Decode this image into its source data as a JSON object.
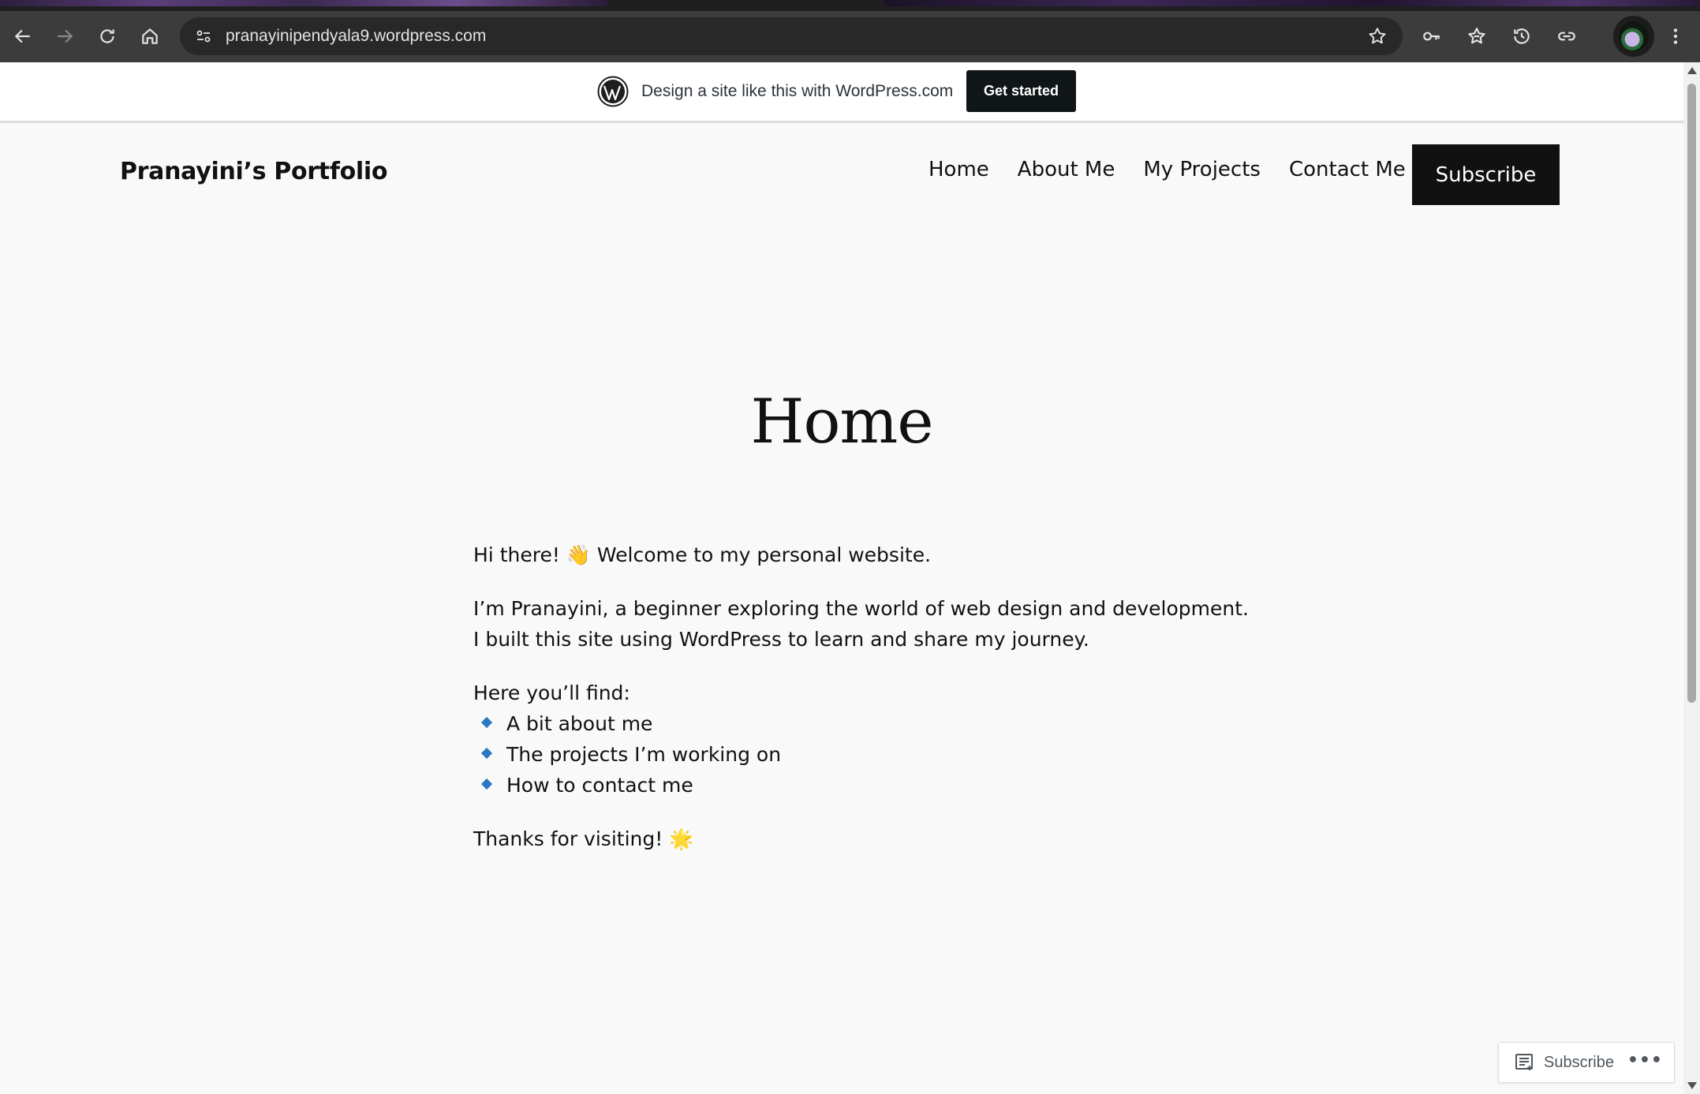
{
  "browser": {
    "url": "pranayinipendyala9.wordpress.com",
    "icons": [
      "back-icon",
      "forward-icon",
      "reload-icon",
      "home-icon",
      "site-info-icon",
      "bookmark-star-icon",
      "password-key-icon",
      "favorites-icon",
      "history-icon",
      "link-icon",
      "profile-avatar",
      "menu-icon"
    ]
  },
  "wp_banner": {
    "text": "Design a site like this with WordPress.com",
    "button": "Get started"
  },
  "site": {
    "title": "Pranayini’s Portfolio",
    "nav": [
      {
        "label": "Home"
      },
      {
        "label": "About Me"
      },
      {
        "label": "My Projects"
      },
      {
        "label": "Contact Me"
      }
    ],
    "subscribe": "Subscribe"
  },
  "page": {
    "title": "Home",
    "intro": "Hi there! 👋 Welcome to my personal website.",
    "about_line1": "I’m Pranayini, a beginner exploring the world of web design and development.",
    "about_line2": "I built this site using WordPress to learn and share my journey.",
    "list_heading": "Here you’ll find:",
    "list_items": [
      "A bit about me",
      "The projects I’m working on",
      "How to contact me"
    ],
    "closing": "Thanks for visiting! 🌟"
  },
  "floating_bar": {
    "subscribe": "Subscribe",
    "more": "•••"
  },
  "colors": {
    "page_bg": "#f9f9f9",
    "text": "#111111",
    "bullet": "#2b79c2",
    "chrome_toolbar": "#3c3c3c"
  }
}
